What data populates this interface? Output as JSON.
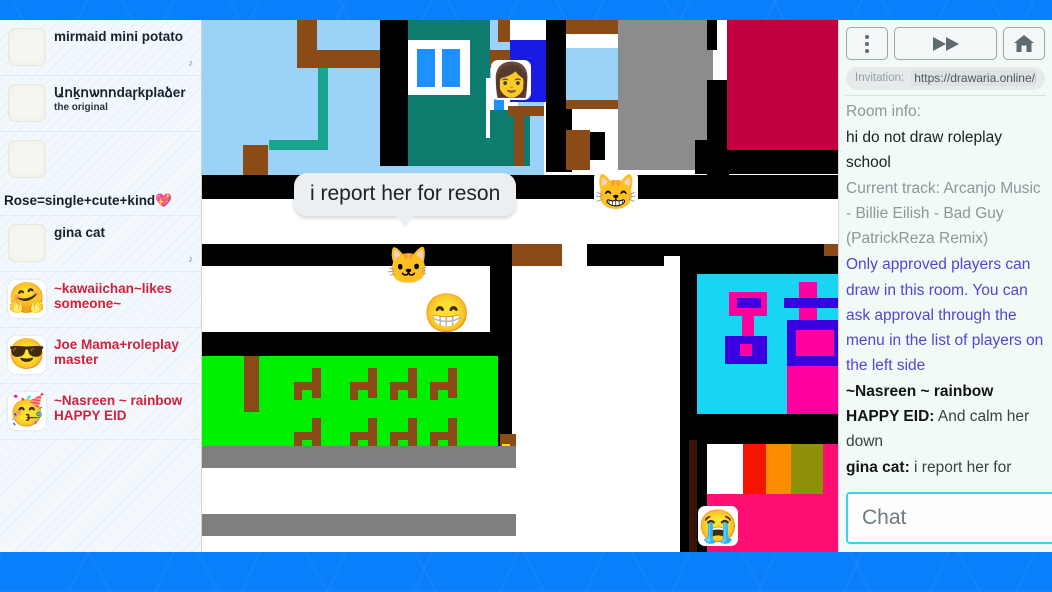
{
  "theme": {
    "backdrop_color": "#0a7ffb",
    "panel_bg": "#f3f8fd",
    "sidebar_bg": "#f1faf4",
    "accent_cyan": "#2fd8f0",
    "name_red": "#d2213b",
    "link_purple": "#5146d4"
  },
  "players_panel": {
    "items": [
      {
        "name": "mirmaid mini potato",
        "sub": "",
        "avatar": "blank-avatar",
        "badge": "music-note-icon",
        "name_below": false,
        "red": false
      },
      {
        "name": "Աոḵոѡոոքаrkplayer",
        "display_name": "Աոḵոѡոոdаɼkplaձer",
        "sub": "the original",
        "avatar": "blank-avatar",
        "badge": "",
        "name_below": false,
        "red": false
      },
      {
        "name": "Rose=single+cute+kind💖",
        "sub": "",
        "avatar": "blank-avatar",
        "badge": "",
        "name_below": true,
        "red": false
      },
      {
        "name": "gina cat",
        "sub": "",
        "avatar": "blank-avatar",
        "badge": "music-note-icon",
        "name_below": false,
        "red": false
      },
      {
        "name": "~kawaiichan~likes someone~",
        "sub": "",
        "avatar": "🤗",
        "badge": "",
        "name_below": false,
        "red": true
      },
      {
        "name": "Joe Mama+roleplay master",
        "sub": "",
        "avatar": "😎",
        "badge": "",
        "name_below": false,
        "red": true
      },
      {
        "name": "~Nasreen ~ rainbow",
        "sub": "HAPPY EID",
        "avatar": "🥳",
        "badge": "",
        "name_below": false,
        "red": true
      }
    ]
  },
  "canvas": {
    "speech_bubble": {
      "text": "i report her for reson",
      "speaker": "gina cat"
    },
    "avatars": [
      {
        "emoji": "👩",
        "name": "avatar-token-teacher"
      },
      {
        "emoji": "😸",
        "name": "avatar-token-cool-cat"
      },
      {
        "emoji": "🐱",
        "name": "avatar-token-cat"
      },
      {
        "emoji": "😁",
        "name": "avatar-token-grin"
      },
      {
        "emoji": "😭",
        "name": "avatar-token-crying"
      }
    ],
    "palette": {
      "sky": "#9bd2f7",
      "teal": "#0d7b6e",
      "brown": "#8a4b17",
      "black": "#000000",
      "white": "#ffffff",
      "blue": "#1e90ff",
      "navy": "#1a1ae6",
      "gray": "#8c8c8c",
      "crimson": "#c2003f",
      "green": "#00ee00",
      "cyan": "#19d4f2",
      "magenta": "#ff00a0",
      "purpleblue": "#3b00e0",
      "pink": "#ff0f73",
      "red": "#f51400",
      "orange": "#fb8b00",
      "olive": "#8f8f09",
      "midgray": "#7f7f7f"
    }
  },
  "sidebar": {
    "toolbar": {
      "menu_label": "menu-icon",
      "fast_forward_label": "fast-forward-icon",
      "home_label": "home-icon"
    },
    "invitation": {
      "label": "Invitation:",
      "url": "https://drawaria.online/roo"
    },
    "messages": [
      {
        "type": "gray",
        "text": "Room info:"
      },
      {
        "type": "dark",
        "text": "hi do not draw roleplay school"
      },
      {
        "type": "gray",
        "text": "Current track: Arcanjo Music - Billie Eilish - Bad Guy (PatrickReza Remix)"
      },
      {
        "type": "purple",
        "text": "Only approved players can draw in this room. You can ask approval through the menu in the list of players on the left side"
      },
      {
        "type": "chat",
        "who": "~Nasreen ~ rainbow HAPPY EID:",
        "body": "And calm her down"
      },
      {
        "type": "chat",
        "who": "gina cat:",
        "body": "i report her for reson"
      }
    ],
    "chat": {
      "placeholder": "Chat",
      "value": "",
      "star_label": "star-icon"
    }
  }
}
